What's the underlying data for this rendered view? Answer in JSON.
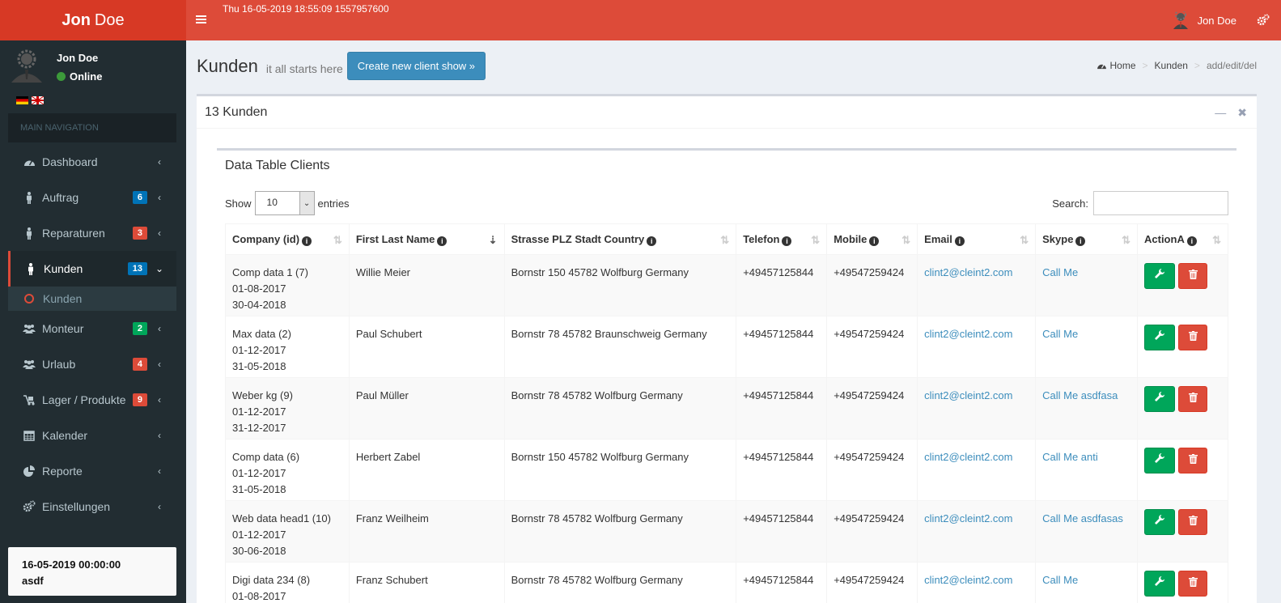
{
  "app": {
    "logo_bold": "Jon",
    "logo_rest": "Doe"
  },
  "topbar": {
    "datetime": "Thu 16-05-2019 18:55:09 1557957600",
    "user": "Jon Doe"
  },
  "sidebar": {
    "user_name": "Jon Doe",
    "status": "Online",
    "nav_header": "MAIN NAVIGATION",
    "items": [
      {
        "label": "Dashboard"
      },
      {
        "label": "Auftrag",
        "badge": "6",
        "badge_color": "#0073b7"
      },
      {
        "label": "Reparaturen",
        "badge": "3",
        "badge_color": "#dd4b39"
      },
      {
        "label": "Kunden",
        "badge": "13",
        "badge_color": "#0073b7"
      },
      {
        "label": "Monteur",
        "badge": "2",
        "badge_color": "#00a65a"
      },
      {
        "label": "Urlaub",
        "badge": "4",
        "badge_color": "#dd4b39"
      },
      {
        "label": "Lager / Produkte",
        "badge": "9",
        "badge_color": "#dd4b39"
      },
      {
        "label": "Kalender"
      },
      {
        "label": "Reporte"
      },
      {
        "label": "Einstellungen"
      }
    ],
    "sub_item": "Kunden",
    "note_date": "16-05-2019 00:00:00",
    "note_text": "asdf"
  },
  "header": {
    "title": "Kunden",
    "subtitle": "it all starts here",
    "create_button": "Create new client show »",
    "breadcrumb": [
      "Home",
      "Kunden",
      "add/edit/del"
    ]
  },
  "box": {
    "title": "13 Kunden",
    "inner_title": "Data Table Clients",
    "show_label": "Show",
    "entries_value": "10",
    "entries_label": "entries",
    "search_label": "Search:"
  },
  "table": {
    "headers": [
      "Company (id)",
      "First Last Name",
      "Strasse PLZ Stadt Country",
      "Telefon",
      "Mobile",
      "Email",
      "Skype",
      "ActionA"
    ],
    "rows": [
      {
        "company": "Comp data 1 (7)",
        "d1": "01-08-2017",
        "d2": "30-04-2018",
        "name": "Willie Meier",
        "addr": "Bornstr 150 45782 Wolfburg Germany",
        "tel": "+49457125844",
        "mobile": "+49547259424",
        "email": "clint2@cleint2.com",
        "skype": "Call Me"
      },
      {
        "company": "Max data (2)",
        "d1": "01-12-2017",
        "d2": "31-05-2018",
        "name": "Paul Schubert",
        "addr": "Bornstr 78 45782 Braunschweig Germany",
        "tel": "+49457125844",
        "mobile": "+49547259424",
        "email": "clint2@cleint2.com",
        "skype": "Call Me"
      },
      {
        "company": "Weber kg (9)",
        "d1": "01-12-2017",
        "d2": "31-12-2017",
        "name": "Paul Müller",
        "addr": "Bornstr 78 45782 Wolfburg Germany",
        "tel": "+49457125844",
        "mobile": "+49547259424",
        "email": "clint2@cleint2.com",
        "skype": "Call Me asdfasa"
      },
      {
        "company": "Comp data (6)",
        "d1": "01-12-2017",
        "d2": "31-05-2018",
        "name": "Herbert Zabel",
        "addr": "Bornstr 150 45782 Wolfburg Germany",
        "tel": "+49457125844",
        "mobile": "+49547259424",
        "email": "clint2@cleint2.com",
        "skype": "Call Me anti"
      },
      {
        "company": "Web data head1 (10)",
        "d1": "01-12-2017",
        "d2": "30-06-2018",
        "name": "Franz Weilheim",
        "addr": "Bornstr 78 45782 Wolfburg Germany",
        "tel": "+49457125844",
        "mobile": "+49547259424",
        "email": "clint2@cleint2.com",
        "skype": "Call Me asdfasas"
      },
      {
        "company": "Digi data 234 (8)",
        "d1": "01-08-2017",
        "d2": "",
        "name": "Franz Schubert",
        "addr": "Bornstr 78 45782 Wolfburg Germany",
        "tel": "+49457125844",
        "mobile": "+49547259424",
        "email": "clint2@cleint2.com",
        "skype": "Call Me"
      }
    ]
  }
}
